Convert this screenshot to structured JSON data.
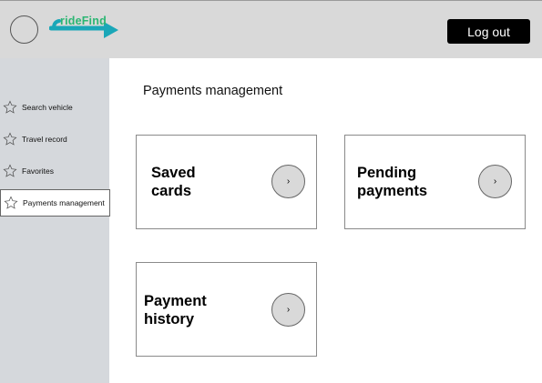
{
  "header": {
    "logo_text": "rideFind",
    "logout_label": "Log out"
  },
  "sidebar": {
    "items": [
      {
        "label": "Search vehicle",
        "icon": "star-icon"
      },
      {
        "label": "Travel record",
        "icon": "star-icon"
      },
      {
        "label": "Favorites",
        "icon": "star-icon"
      },
      {
        "label": "Payments management",
        "icon": "star-icon",
        "active": true
      }
    ]
  },
  "main": {
    "title": "Payments management",
    "cards": [
      {
        "title_line1": "Saved",
        "title_line2": "cards",
        "arrow": "›"
      },
      {
        "title_line1": "Pending",
        "title_line2": "payments",
        "arrow": "›"
      },
      {
        "title_line1": "Payment",
        "title_line2": "history",
        "arrow": "›"
      }
    ]
  },
  "colors": {
    "header_bg": "#d9d9d9",
    "sidebar_bg": "#d5d8dc",
    "logo_accent": "#1aa7b8",
    "logo_text": "#2bb673",
    "button_bg": "#000000"
  }
}
